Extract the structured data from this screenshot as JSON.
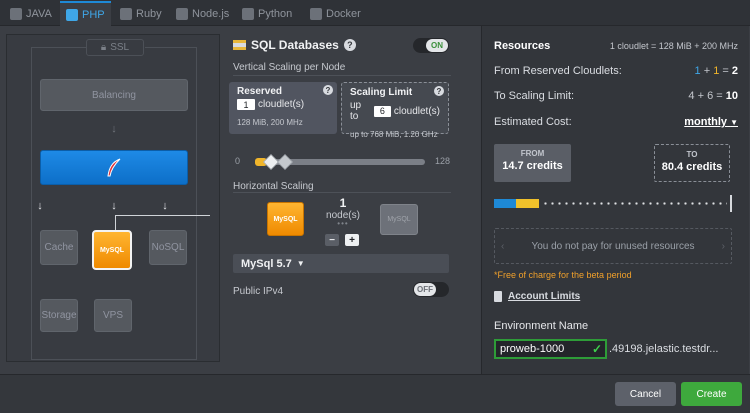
{
  "tabs": [
    {
      "label": "JAVA",
      "icon": "java-icon",
      "active": false
    },
    {
      "label": "PHP",
      "icon": "php-icon",
      "active": true
    },
    {
      "label": "Ruby",
      "icon": "ruby-icon",
      "active": false
    },
    {
      "label": "Node.js",
      "icon": "nodejs-icon",
      "active": false
    },
    {
      "label": "Python",
      "icon": "python-icon",
      "active": false
    },
    {
      "label": "Docker",
      "icon": "docker-icon",
      "active": false
    }
  ],
  "topology": {
    "ssl_label": "SSL",
    "balancing_label": "Balancing",
    "cache_label": "Cache",
    "mysql_label": "MySQL",
    "nosql_label": "NoSQL",
    "storage_label": "Storage",
    "vps_label": "VPS"
  },
  "sql": {
    "title": "SQL Databases",
    "enabled_label": "ON",
    "vertical_label": "Vertical Scaling per Node",
    "reserved": {
      "title": "Reserved",
      "value": "1",
      "unit": "cloudlet(s)",
      "info": "128 MiB, 200 MHz"
    },
    "limit": {
      "title": "Scaling Limit",
      "prefix": "up to",
      "value": "6",
      "unit": "cloudlet(s)",
      "info": "up to 768 MiB, 1.20 GHz"
    },
    "slider": {
      "min": "0",
      "max": "128",
      "reserved": 1,
      "limit": 6
    },
    "horizontal_label": "Horizontal Scaling",
    "node_count": "1",
    "node_unit": "node(s)",
    "node_logo_label": "MySQL",
    "ghost_logo_label": "MySQL",
    "minus_label": "−",
    "plus_label": "+",
    "version": "MySql 5.7",
    "ipv4_label": "Public IPv4",
    "ipv4_toggle": "OFF"
  },
  "resources": {
    "title": "Resources",
    "cloudlet_note": "1 cloudlet = 128 MiB + 200 MHz",
    "reserved_label": "From Reserved Cloudlets:",
    "reserved_a": "1",
    "reserved_b": "1",
    "reserved_total": "2",
    "limit_label": "To Scaling Limit:",
    "limit_expr": "4 + 6 =",
    "limit_total": "10",
    "cost_label": "Estimated Cost:",
    "cost_period": "monthly",
    "from_title": "FROM",
    "from_value": "14.7 credits",
    "to_title": "TO",
    "to_value": "80.4 credits",
    "unused_text": "You do not pay for unused resources",
    "free_note": "*Free of charge for the beta period",
    "account_limits": "Account Limits",
    "env_label": "Environment Name",
    "env_value": "proweb-1000",
    "env_domain": ".49198.jelastic.testdr...",
    "colors": {
      "blue": "#3fa7e8",
      "yellow": "#f0b52b",
      "valid": "#2e9c38"
    }
  },
  "footer": {
    "cancel": "Cancel",
    "create": "Create"
  }
}
